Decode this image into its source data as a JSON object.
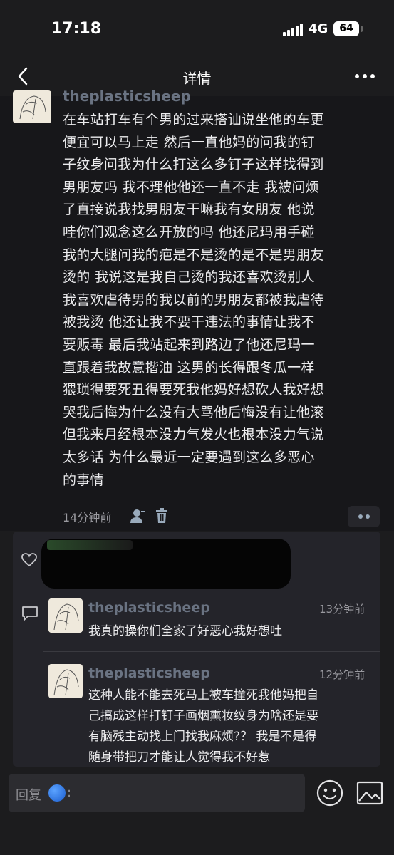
{
  "status_bar": {
    "time": "17:18",
    "network": "4G",
    "battery": "64"
  },
  "nav": {
    "title": "详情",
    "back_icon": "chevron-left-icon",
    "more_icon": "more-dots-icon"
  },
  "post": {
    "username": "theplasticsheep",
    "lines": [
      "在车站打车有个男的过来搭讪说坐他的车更",
      "便宜可以马上走 然后一直他妈的问我的钉",
      "子纹身问我为什么打这么多钉子这样找得到",
      "男朋友吗 我不理他他还一直不走 我被问烦",
      "了直接说我找男朋友干嘛我有女朋友 他说",
      "哇你们观念这么开放的吗 他还尼玛用手碰",
      "我的大腿问我的疤是不是烫的是不是男朋友",
      "烫的 我说这是我自己烫的我还喜欢烫别人",
      "我喜欢虐待男的我以前的男朋友都被我虐待",
      "被我烫 他还让我不要干违法的事情让我不",
      "要贩毒 最后我站起来到路边了他还尼玛一",
      "直跟着我故意揩油 这男的长得跟冬瓜一样",
      "猥琐得要死丑得要死我他妈好想砍人我好想",
      "哭我后悔为什么没有大骂他后悔没有让他滚",
      "但我来月经根本没力气发火也根本没力气说",
      "太多话 为什么最近一定要遇到这么多恶心",
      "的事情"
    ],
    "time": "14分钟前"
  },
  "comments": [
    {
      "username": "theplasticsheep",
      "time": "13分钟前",
      "lines": [
        "我真的操你们全家了好恶心我好想吐"
      ]
    },
    {
      "username": "theplasticsheep",
      "time": "12分钟前",
      "lines": [
        "这种人能不能去死马上被车撞死我他妈把自",
        "己搞成这样打钉子画烟熏妆纹身为啥还是要",
        "有脑残主动找上门找我麻烦?？ 我是不是得",
        "随身带把刀才能让人觉得我不好惹"
      ]
    }
  ],
  "reply": {
    "label": "回复",
    "colon": ":"
  },
  "icons": [
    "heart-icon",
    "comment-icon",
    "user-icon",
    "trash-icon",
    "emoji-icon",
    "image-icon"
  ],
  "colors": {
    "background": "#1c1c1e",
    "username": "#6a7382",
    "text": "#ececee",
    "muted": "#9a9aa0"
  }
}
